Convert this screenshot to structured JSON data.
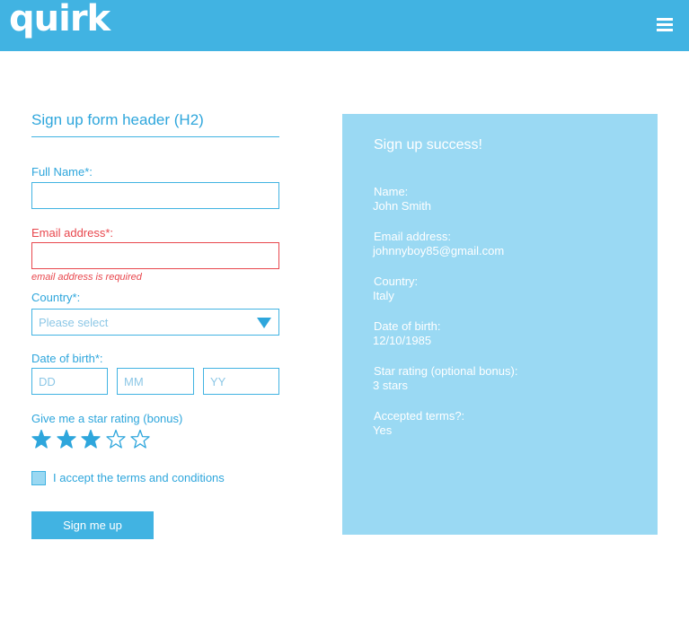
{
  "header": {
    "logo_text": "quirk",
    "menu_icon": "hamburger-menu-icon",
    "background": "#41b3e2"
  },
  "form": {
    "title": "Sign up form header (H2)",
    "full_name_label": "Full Name*:",
    "full_name_value": "",
    "email_label": "Email address*:",
    "email_value": "",
    "email_error": "email address is required",
    "country_label": "Country*:",
    "country_selected": "Please select",
    "dob_label": "Date of birth*:",
    "dob_day_placeholder": "DD",
    "dob_month_placeholder": "MM",
    "dob_year_placeholder": "YY",
    "rating_label": "Give me a star rating (bonus)",
    "rating_value": 3,
    "rating_max": 5,
    "terms_label": "I accept the terms and conditions",
    "submit_label": "Sign me up",
    "accent_color": "#41b3e2",
    "error_color": "#e8474d"
  },
  "success": {
    "title": "Sign up success!",
    "name_label": "Name:",
    "name_value": "John Smith",
    "email_label": "Email address:",
    "email_value": "johnnyboy85@gmail.com",
    "country_label": "Country:",
    "country_value": "Italy",
    "dob_label": "Date of birth:",
    "dob_value": "12/10/1985",
    "rating_label": "Star rating (optional bonus):",
    "rating_value": "3 stars",
    "terms_label": "Accepted terms?:",
    "terms_value": "Yes",
    "background": "#9ad9f3"
  }
}
